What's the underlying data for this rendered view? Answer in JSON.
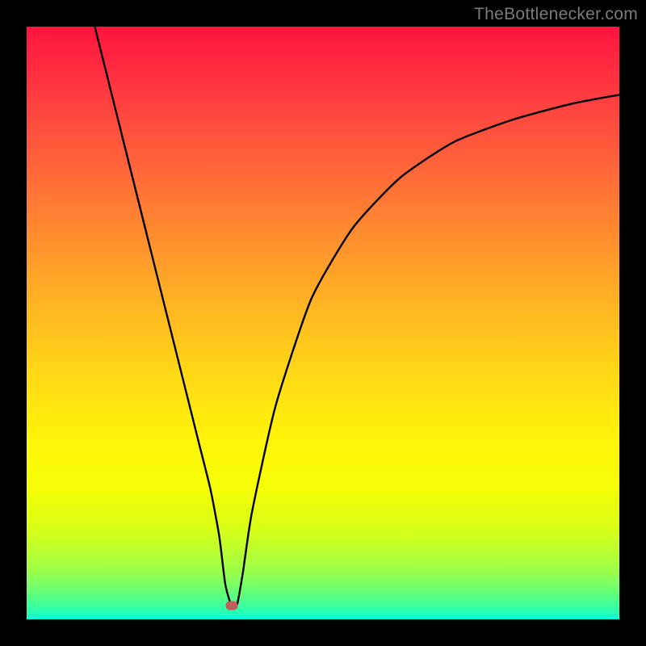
{
  "attribution": "TheBottlenecker.com",
  "chart_data": {
    "type": "line",
    "title": "",
    "xlabel": "",
    "ylabel": "",
    "xlim": [
      0,
      100
    ],
    "ylim": [
      0,
      100
    ],
    "series": [
      {
        "name": "bottleneck-curve",
        "x": [
          11.5,
          15,
          20,
          25,
          29,
          31,
          32.5,
          33.5,
          34.5,
          35.5,
          36.5,
          38,
          42,
          48,
          55,
          63,
          72,
          82,
          92,
          100
        ],
        "y": [
          100,
          86,
          66,
          46,
          30,
          22,
          14,
          6,
          2.5,
          2.5,
          8,
          18,
          36,
          54,
          66,
          74.5,
          80.5,
          84.3,
          87,
          88.5
        ]
      }
    ],
    "marker": {
      "x": 34.6,
      "y": 2.3
    },
    "colors": {
      "gradient_top": "#ff143c",
      "gradient_mid": "#ffd716",
      "gradient_bottom": "#06ffe4",
      "curve": "#000000",
      "marker": "#c45d5d",
      "frame": "#000000"
    }
  }
}
